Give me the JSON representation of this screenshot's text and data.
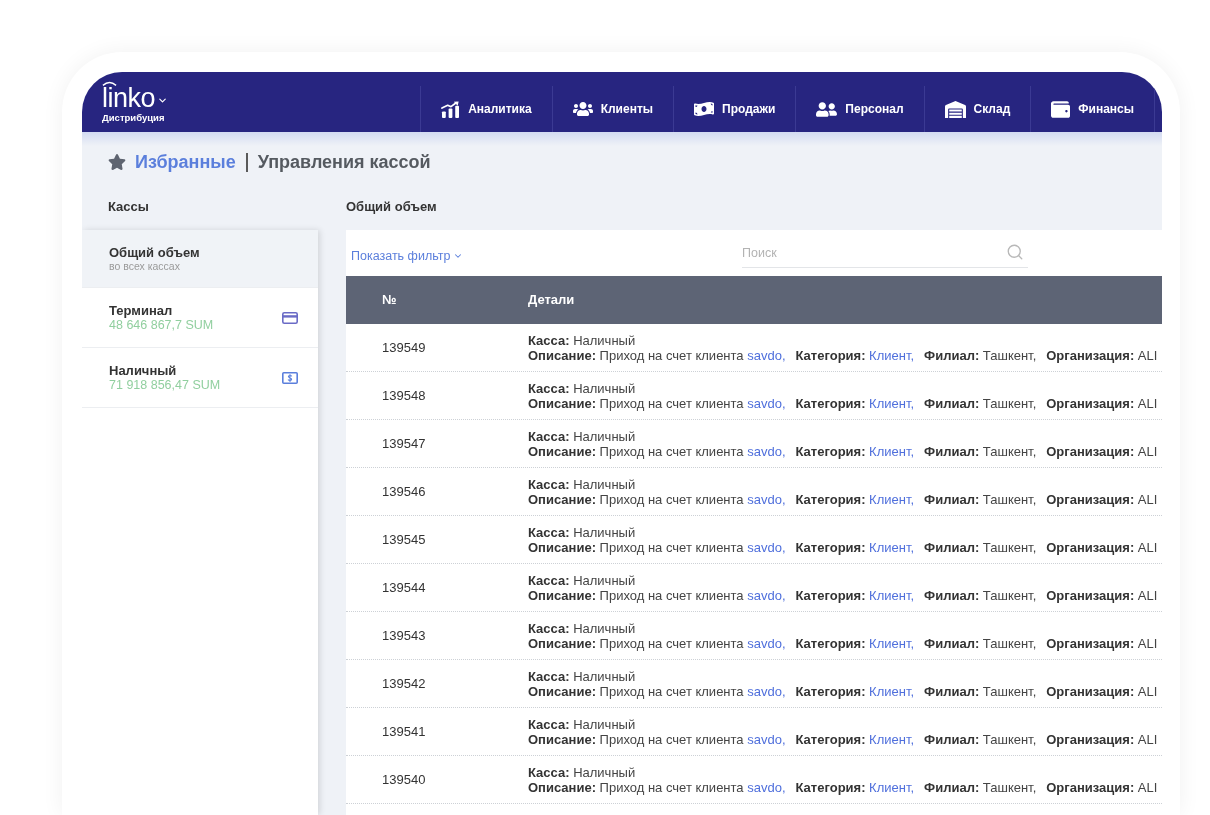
{
  "header": {
    "logo": "linko",
    "subtitle": "Дистрибуция",
    "nav": [
      "Аналитика",
      "Клиенты",
      "Продажи",
      "Персонал",
      "Склад",
      "Финансы"
    ]
  },
  "breadcrumb": {
    "favorites": "Избранные",
    "title": "Управления кассой"
  },
  "cashboxes": {
    "title": "Кассы",
    "items": [
      {
        "kind": "total",
        "name": "Общий объем",
        "subtitle": "во всех кассах",
        "selected": true
      },
      {
        "kind": "card",
        "name": "Терминал",
        "amount": "48 646 867,7 SUM",
        "selected": false
      },
      {
        "kind": "cash",
        "name": "Наличный",
        "amount": "71 918 856,47 SUM",
        "selected": false
      }
    ]
  },
  "transactions": {
    "title": "Общий объем",
    "filter": "Показать фильтр",
    "search": {
      "placeholder": "Поиск"
    },
    "columns": [
      "№",
      "Детали"
    ],
    "rows": [
      {
        "number": "139549",
        "lines": [
          [
            {
              "label": "Касса:",
              "value": "Наличный"
            }
          ],
          [
            {
              "label": "Описание:",
              "value": "Приход на счет клиента",
              "link": "savdo,"
            },
            {
              "label": "Категория:",
              "link": "Клиент,"
            },
            {
              "label": "Филиал:",
              "value": "Ташкент,"
            },
            {
              "label": "Организация:",
              "value": "ALI"
            }
          ]
        ]
      },
      {
        "number": "139548",
        "lines": [
          [
            {
              "label": "Касса:",
              "value": "Наличный"
            }
          ],
          [
            {
              "label": "Описание:",
              "value": "Приход на счет клиента",
              "link": "savdo,"
            },
            {
              "label": "Категория:",
              "link": "Клиент,"
            },
            {
              "label": "Филиал:",
              "value": "Ташкент,"
            },
            {
              "label": "Организация:",
              "value": "ALI"
            }
          ]
        ]
      },
      {
        "number": "139547",
        "lines": [
          [
            {
              "label": "Касса:",
              "value": "Наличный"
            }
          ],
          [
            {
              "label": "Описание:",
              "value": "Приход на счет клиента",
              "link": "savdo,"
            },
            {
              "label": "Категория:",
              "link": "Клиент,"
            },
            {
              "label": "Филиал:",
              "value": "Ташкент,"
            },
            {
              "label": "Организация:",
              "value": "ALI"
            }
          ]
        ]
      },
      {
        "number": "139546",
        "lines": [
          [
            {
              "label": "Касса:",
              "value": "Наличный"
            }
          ],
          [
            {
              "label": "Описание:",
              "value": "Приход на счет клиента",
              "link": "savdo,"
            },
            {
              "label": "Категория:",
              "link": "Клиент,"
            },
            {
              "label": "Филиал:",
              "value": "Ташкент,"
            },
            {
              "label": "Организация:",
              "value": "ALI"
            }
          ]
        ]
      },
      {
        "number": "139545",
        "lines": [
          [
            {
              "label": "Касса:",
              "value": "Наличный"
            }
          ],
          [
            {
              "label": "Описание:",
              "value": "Приход на счет клиента",
              "link": "savdo,"
            },
            {
              "label": "Категория:",
              "link": "Клиент,"
            },
            {
              "label": "Филиал:",
              "value": "Ташкент,"
            },
            {
              "label": "Организация:",
              "value": "ALI"
            }
          ]
        ]
      },
      {
        "number": "139544",
        "lines": [
          [
            {
              "label": "Касса:",
              "value": "Наличный"
            }
          ],
          [
            {
              "label": "Описание:",
              "value": "Приход на счет клиента",
              "link": "savdo,"
            },
            {
              "label": "Категория:",
              "link": "Клиент,"
            },
            {
              "label": "Филиал:",
              "value": "Ташкент,"
            },
            {
              "label": "Организация:",
              "value": "ALI"
            }
          ]
        ]
      },
      {
        "number": "139543",
        "lines": [
          [
            {
              "label": "Касса:",
              "value": "Наличный"
            }
          ],
          [
            {
              "label": "Описание:",
              "value": "Приход на счет клиента",
              "link": "savdo,"
            },
            {
              "label": "Категория:",
              "link": "Клиент,"
            },
            {
              "label": "Филиал:",
              "value": "Ташкент,"
            },
            {
              "label": "Организация:",
              "value": "ALI"
            }
          ]
        ]
      },
      {
        "number": "139542",
        "lines": [
          [
            {
              "label": "Касса:",
              "value": "Наличный"
            }
          ],
          [
            {
              "label": "Описание:",
              "value": "Приход на счет клиента",
              "link": "savdo,"
            },
            {
              "label": "Категория:",
              "link": "Клиент,"
            },
            {
              "label": "Филиал:",
              "value": "Ташкент,"
            },
            {
              "label": "Организация:",
              "value": "ALI"
            }
          ]
        ]
      },
      {
        "number": "139541",
        "lines": [
          [
            {
              "label": "Касса:",
              "value": "Наличный"
            }
          ],
          [
            {
              "label": "Описание:",
              "value": "Приход на счет клиента",
              "link": "savdo,"
            },
            {
              "label": "Категория:",
              "link": "Клиент,"
            },
            {
              "label": "Филиал:",
              "value": "Ташкент,"
            },
            {
              "label": "Организация:",
              "value": "ALI"
            }
          ]
        ]
      },
      {
        "number": "139540",
        "lines": [
          [
            {
              "label": "Касса:",
              "value": "Наличный"
            }
          ],
          [
            {
              "label": "Описание:",
              "value": "Приход на счет клиента",
              "link": "savdo,"
            },
            {
              "label": "Категория:",
              "link": "Клиент,"
            },
            {
              "label": "Филиал:",
              "value": "Ташкент,"
            },
            {
              "label": "Организация:",
              "value": "ALI"
            }
          ]
        ]
      }
    ]
  }
}
